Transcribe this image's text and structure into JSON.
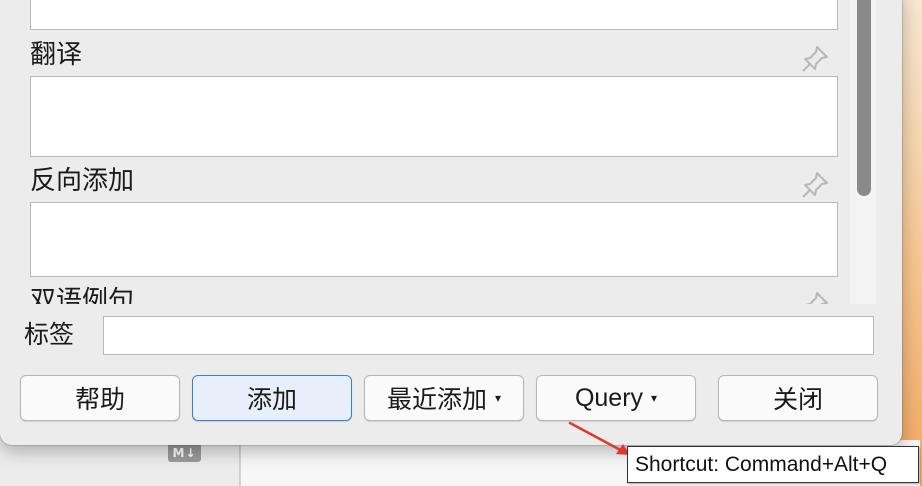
{
  "fields": [
    {
      "label": "翻译",
      "value": ""
    },
    {
      "label": "反向添加",
      "value": ""
    },
    {
      "label": "双语例句",
      "value": ""
    }
  ],
  "tags": {
    "label": "标签",
    "value": ""
  },
  "buttons": {
    "help": "帮助",
    "add": "添加",
    "recent_add": "最近添加",
    "query": "Query",
    "close": "关闭",
    "caret": "▾"
  },
  "tooltip": {
    "text": "Shortcut: Command+Alt+Q"
  },
  "badge": {
    "text": "M↓"
  },
  "icons": {
    "pin": "pin-icon",
    "dropdown": "caret-down-icon",
    "arrow": "red-arrow-icon"
  },
  "colors": {
    "accent": "#3b7ee0",
    "arrow": "#e0392b",
    "dialog_bg": "#ececec"
  }
}
